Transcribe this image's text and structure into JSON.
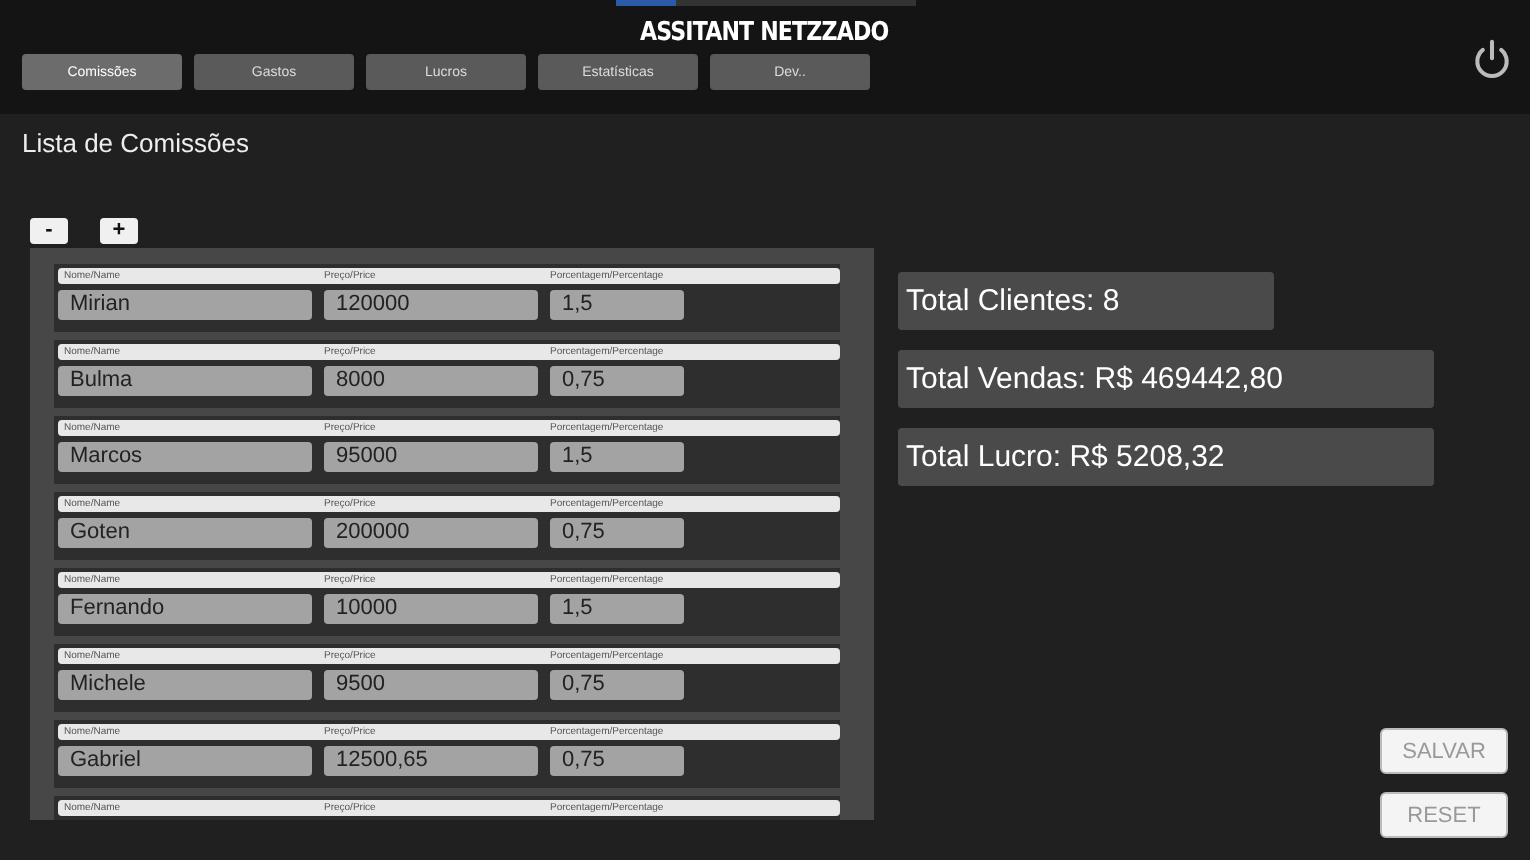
{
  "app": {
    "title": "ASSITANT NETZZADO"
  },
  "tabs": [
    {
      "label": "Comissões",
      "selected": true
    },
    {
      "label": "Gastos",
      "selected": false
    },
    {
      "label": "Lucros",
      "selected": false
    },
    {
      "label": "Estatísticas",
      "selected": false
    },
    {
      "label": "Dev..",
      "selected": false
    }
  ],
  "page": {
    "title": "Lista de Comissões"
  },
  "row_buttons": [
    "-",
    "+"
  ],
  "rows": [
    {
      "kind": "full",
      "name_label": "Nome/Name",
      "price_label": "Preço/Price",
      "pct_label": "Porcentagem/Percentage",
      "name": "Mirian",
      "price": "120000",
      "pct": "1,5"
    },
    {
      "kind": "full",
      "name_label": "Nome/Name",
      "price_label": "Preço/Price",
      "pct_label": "Porcentagem/Percentage",
      "name": "Bulma",
      "price": "8000",
      "pct": "0,75"
    },
    {
      "kind": "full",
      "name_label": "Nome/Name",
      "price_label": "Preço/Price",
      "pct_label": "Porcentagem/Percentage",
      "name": "Marcos",
      "price": "95000",
      "pct": "1,5"
    },
    {
      "kind": "full",
      "name_label": "Nome/Name",
      "price_label": "Preço/Price",
      "pct_label": "Porcentagem/Percentage",
      "name": "Goten",
      "price": "200000",
      "pct": "0,75"
    },
    {
      "kind": "full",
      "name_label": "Nome/Name",
      "price_label": "Preço/Price",
      "pct_label": "Porcentagem/Percentage",
      "name": "Fernando",
      "price": "10000",
      "pct": "1,5"
    },
    {
      "kind": "full",
      "name_label": "Nome/Name",
      "price_label": "Preço/Price",
      "pct_label": "Porcentagem/Percentage",
      "name": "Michele",
      "price": "9500",
      "pct": "0,75"
    },
    {
      "kind": "full",
      "name_label": "Nome/Name",
      "price_label": "Preço/Price",
      "pct_label": "Porcentagem/Percentage",
      "name": "Gabriel",
      "price": "12500,65",
      "pct": "0,75"
    },
    {
      "kind": "labels",
      "name_label": "Nome/Name",
      "price_label": "Preço/Price",
      "pct_label": "Porcentagem/Percentage"
    }
  ],
  "totals": [
    "Total Clientes: 8",
    "Total Vendas: R$ 469442,80",
    "Total Lucro: R$ 5208,32"
  ],
  "actions": [
    "SALVAR",
    "RESET"
  ]
}
